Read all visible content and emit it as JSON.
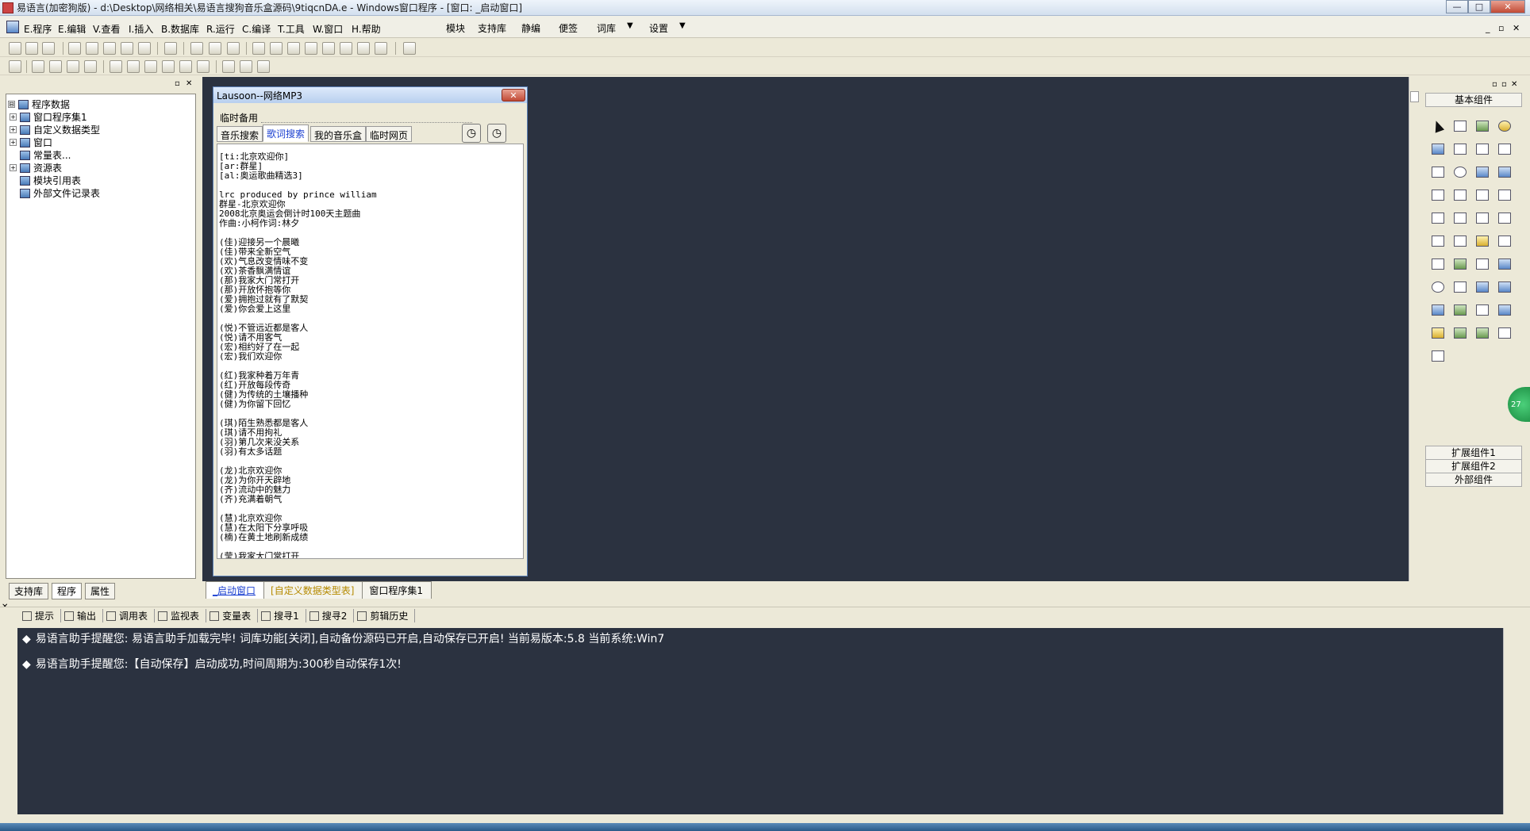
{
  "window": {
    "title": "易语言(加密狗版) - d:\\Desktop\\网络相关\\易语言搜狗音乐盒源码\\9tiqcnDA.e - Windows窗口程序 - [窗口: _启动窗口]",
    "min_label": "—",
    "max_label": "□",
    "close_label": "✕"
  },
  "menubar": {
    "items": [
      "E.程序",
      "E.编辑",
      "V.查看",
      "I.插入",
      "B.数据库",
      "R.运行",
      "C.编译",
      "T.工具",
      "W.窗口",
      "H.帮助"
    ],
    "extras": [
      "模块",
      "支持库",
      "静编",
      "便签",
      "词库",
      "设置"
    ],
    "dropdown_arrow": "▼",
    "mdi_buttons": [
      "_",
      "▫",
      "✕"
    ]
  },
  "left_panel": {
    "header_buttons": [
      "▫",
      "✕"
    ],
    "tree": [
      {
        "label": "程序数据",
        "expander": "⊟",
        "level": 0
      },
      {
        "label": "窗口程序集1",
        "expander": "+",
        "level": 1
      },
      {
        "label": "自定义数据类型",
        "expander": "+",
        "level": 1
      },
      {
        "label": "窗口",
        "expander": "+",
        "level": 1
      },
      {
        "label": "常量表...",
        "expander": "",
        "level": 1
      },
      {
        "label": "资源表",
        "expander": "+",
        "level": 1
      },
      {
        "label": "模块引用表",
        "expander": "",
        "level": 1
      },
      {
        "label": "外部文件记录表",
        "expander": "",
        "level": 1
      }
    ],
    "tabs": [
      "支持库",
      "程序",
      "属性"
    ]
  },
  "form": {
    "title": "Lausoon--网络MP3",
    "close": "✕",
    "menu_label": "临时备用",
    "tabs": [
      "音乐搜索",
      "歌词搜索",
      "我的音乐盒",
      "临时网页"
    ],
    "active_tab": 1,
    "timer_icon": "◷",
    "lyrics": [
      "[ti:北京欢迎你]",
      "[ar:群星]",
      "[al:奥运歌曲精选3]",
      "",
      "lrc produced by prince william",
      "群星-北京欢迎你",
      "2008北京奥运会倒计时100天主题曲",
      "作曲:小柯作词:林夕",
      "",
      "(佳)迎接另一个晨曦",
      "(佳)带来全新空气",
      "(欢)气息改变情味不变",
      "(欢)茶香飘满情谊",
      "(那)我家大门常打开",
      "(那)开放怀抱等你",
      "(爱)拥抱过就有了默契",
      "(爱)你会爱上这里",
      "",
      "(悦)不管远近都是客人",
      "(悦)请不用客气",
      "(宏)相约好了在一起",
      "(宏)我们欢迎你",
      "",
      "(红)我家种着万年青",
      "(红)开放每段传奇",
      "(健)为传统的土壤播种",
      "(健)为你留下回忆",
      "",
      "(琪)陌生熟悉都是客人",
      "(琪)请不用拘礼",
      "(羽)第几次来没关系",
      "(羽)有太多话题",
      "",
      "(龙)北京欢迎你",
      "(龙)为你开天辟地",
      "(齐)流动中的魅力",
      "(齐)充满着朝气",
      "",
      "(慧)北京欢迎你",
      "(慧)在太阳下分享呼吸",
      "(楠)在黄土地刷新成绩",
      "",
      "(莹)我家大门常打开"
    ]
  },
  "doc_tabs": [
    "_启动窗口",
    "[自定义数据类型表]",
    "窗口程序集1"
  ],
  "right_panel": {
    "header_buttons": [
      "▫",
      "▫",
      "✕"
    ],
    "title": "基本组件",
    "buttons": [
      "扩展组件1",
      "扩展组件2",
      "外部组件"
    ],
    "badge": "27"
  },
  "bottom_tabs": [
    "提示",
    "输出",
    "调用表",
    "监视表",
    "变量表",
    "搜寻1",
    "搜寻2",
    "剪辑历史"
  ],
  "output_lines": [
    "易语言助手提醒您:  易语言助手加载完毕! 词库功能[关闭],自动备份源码已开启,自动保存已开启! 当前易版本:5.8  当前系统:Win7",
    "易语言助手提醒您:【自动保存】启动成功,时间周期为:300秒自动保存1次!"
  ],
  "bullet": "◆"
}
